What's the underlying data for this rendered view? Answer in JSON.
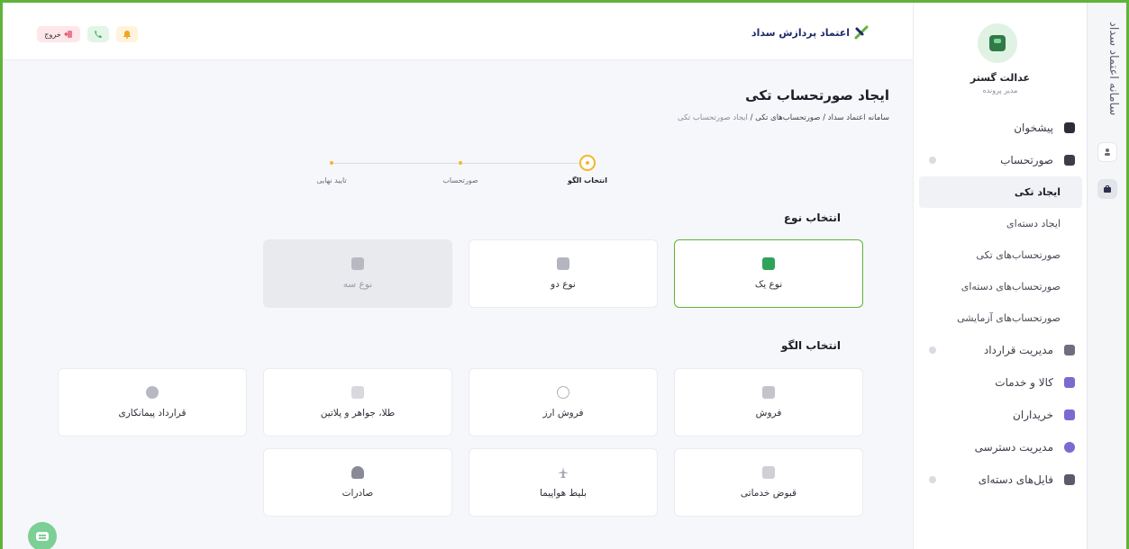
{
  "rail": {
    "title": "سامانه اعتماد سداد"
  },
  "sidebar": {
    "user_name": "عدالت گستر",
    "user_role": "مدیر پرونده",
    "items": [
      {
        "label": "پیشخوان",
        "icon": "dashboard-icon",
        "color": "#2c2c3a"
      },
      {
        "label": "صورتحساب",
        "icon": "invoice-icon",
        "color": "#3c3c4a"
      },
      {
        "label": "مدیریت قرارداد",
        "icon": "contract-icon",
        "color": "#6e6e7e"
      },
      {
        "label": "کالا و خدمات",
        "icon": "cube-icon",
        "color": "#7a6bd1"
      },
      {
        "label": "خریداران",
        "icon": "buyers-icon",
        "color": "#7a6bd1"
      },
      {
        "label": "مدیریت دسترسی",
        "icon": "access-icon",
        "color": "#7a6bd1"
      },
      {
        "label": "فایل‌های دسته‌ای",
        "icon": "files-icon",
        "color": "#5b5b6b"
      }
    ],
    "sub_items": [
      {
        "label": "ایجاد تکی"
      },
      {
        "label": "ایجاد دسته‌ای"
      },
      {
        "label": "صورتحساب‌های تکی"
      },
      {
        "label": "صورتحساب‌های دسته‌ای"
      },
      {
        "label": "صورتحساب‌های آزمایشی"
      }
    ]
  },
  "topbar": {
    "logo_text": "اعتماد پردازش سداد",
    "exit_label": "خروج"
  },
  "page": {
    "title": "ایجاد صورتحساب تکی",
    "breadcrumb": [
      "سامانه اعتماد سداد",
      "/",
      "صورتحساب‌های تکی",
      "/",
      "ایجاد صورتحساب تکی"
    ]
  },
  "stepper": {
    "steps": [
      "انتخاب الگو",
      "صورتحساب",
      "تایید نهایی"
    ],
    "active_step": 1,
    "accent": "#f2b829"
  },
  "type_section": {
    "title": "انتخاب نوع",
    "cards": [
      {
        "label": "نوع یک",
        "icon": "receipt-icon",
        "state": "selected",
        "color": "#2fa35a"
      },
      {
        "label": "نوع دو",
        "icon": "receipt-icon",
        "state": "normal",
        "color": "#8a8a96"
      },
      {
        "label": "نوع سه",
        "icon": "receipt-icon",
        "state": "disabled",
        "color": "#a5a5b0"
      }
    ]
  },
  "pattern_section": {
    "title": "انتخاب الگو",
    "cards": [
      {
        "label": "فروش",
        "icon": "cart-icon"
      },
      {
        "label": "فروش ارز",
        "icon": "currency-icon"
      },
      {
        "label": "طلا، جواهر و پلاتین",
        "icon": "crown-icon"
      },
      {
        "label": "قرارداد پیمانکاری",
        "icon": "badge-icon"
      },
      {
        "label": "قبوض خدماتی",
        "icon": "bill-icon"
      },
      {
        "label": "بلیط هواپیما",
        "icon": "airplane-icon"
      },
      {
        "label": "صادرات",
        "icon": "ship-icon"
      }
    ]
  },
  "colors": {
    "brand_green": "#5fb33a",
    "accent_yellow": "#f2b829",
    "navy": "#1d2a6a"
  }
}
